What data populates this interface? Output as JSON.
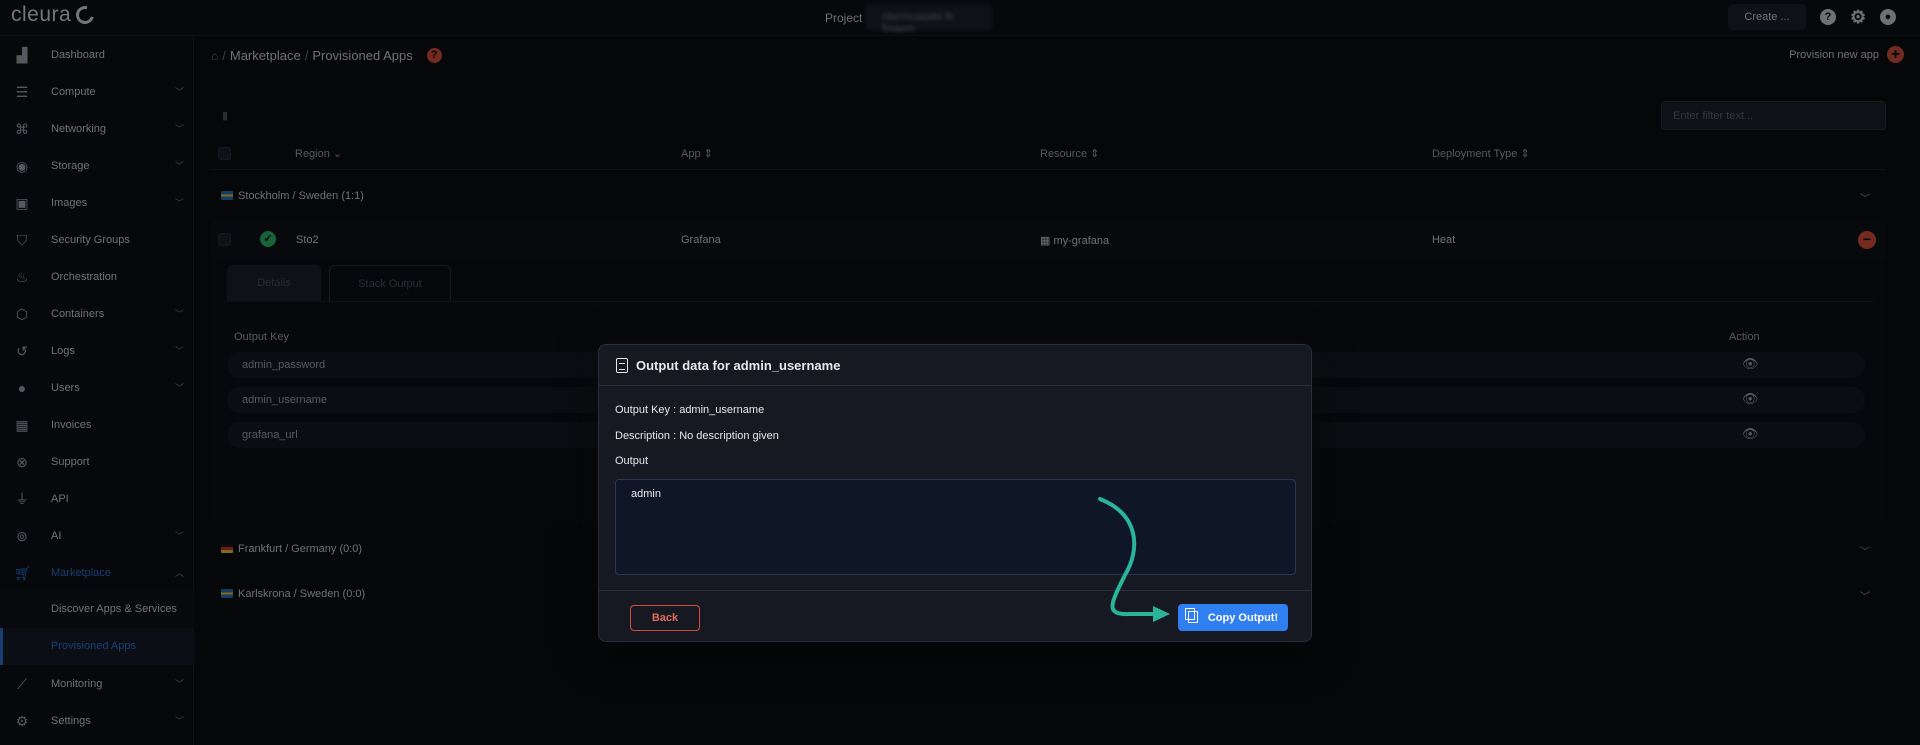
{
  "app": {
    "logo_text": "cleura"
  },
  "topbar": {
    "project_label": "Project",
    "project_value": "ritermuaoilbi fir finaem",
    "create_label": "Create ..."
  },
  "sidebar": {
    "items": [
      {
        "label": "Dashboard",
        "icon": "chart-icon"
      },
      {
        "label": "Compute",
        "icon": "server-icon"
      },
      {
        "label": "Networking",
        "icon": "network-icon"
      },
      {
        "label": "Storage",
        "icon": "database-icon"
      },
      {
        "label": "Images",
        "icon": "camera-icon"
      },
      {
        "label": "Security Groups",
        "icon": "shield-icon"
      },
      {
        "label": "Orchestration",
        "icon": "flame-icon"
      },
      {
        "label": "Containers",
        "icon": "cube-icon"
      },
      {
        "label": "Logs",
        "icon": "history-icon"
      },
      {
        "label": "Users",
        "icon": "user-icon"
      },
      {
        "label": "Invoices",
        "icon": "calculator-icon"
      },
      {
        "label": "Support",
        "icon": "lifebuoy-icon"
      },
      {
        "label": "API",
        "icon": "plug-icon"
      },
      {
        "label": "AI",
        "icon": "ai-icon"
      },
      {
        "label": "Marketplace",
        "icon": "cart-icon"
      },
      {
        "label": "Monitoring",
        "icon": "line-chart-icon"
      },
      {
        "label": "Settings",
        "icon": "gear-icon"
      }
    ],
    "marketplace_sub": [
      {
        "label": "Discover Apps & Services"
      },
      {
        "label": "Provisioned Apps"
      }
    ]
  },
  "main": {
    "breadcrumb": {
      "marketplace": "Marketplace",
      "separator": "/",
      "current": "Provisioned Apps"
    },
    "provision_label": "Provision new app",
    "filter_placeholder": "Enter filter text...",
    "columns": {
      "region": "Region",
      "app": "App",
      "resource": "Resource",
      "deployment_type": "Deployment Type"
    },
    "groups": [
      {
        "label": "Stockholm / Sweden  (1:1)"
      },
      {
        "label": "Frankfurt / Germany  (0:0)"
      },
      {
        "label": "Karlskrona / Sweden  (0:0)"
      }
    ],
    "row": {
      "region": "Sto2",
      "app": "Grafana",
      "resource": "my-grafana",
      "deployment_type": "Heat"
    },
    "tabs": [
      {
        "label": "Details"
      },
      {
        "label": "Stack Output"
      }
    ],
    "output_table": {
      "key_header": "Output Key",
      "action_header": "Action",
      "rows": [
        {
          "key": "admin_password"
        },
        {
          "key": "admin_username"
        },
        {
          "key": "grafana_url"
        }
      ]
    }
  },
  "modal": {
    "title": "Output data for admin_username",
    "output_key_line": "Output Key : admin_username",
    "description_line": "Description : No description given",
    "output_label": "Output",
    "output_value": "admin",
    "back_label": "Back",
    "copy_label": "Copy Output!"
  },
  "colors": {
    "accent_blue": "#2f7ff0",
    "danger_red": "#d44e3a",
    "success_green": "#2fb36b",
    "annotation_teal": "#2ab59b"
  }
}
